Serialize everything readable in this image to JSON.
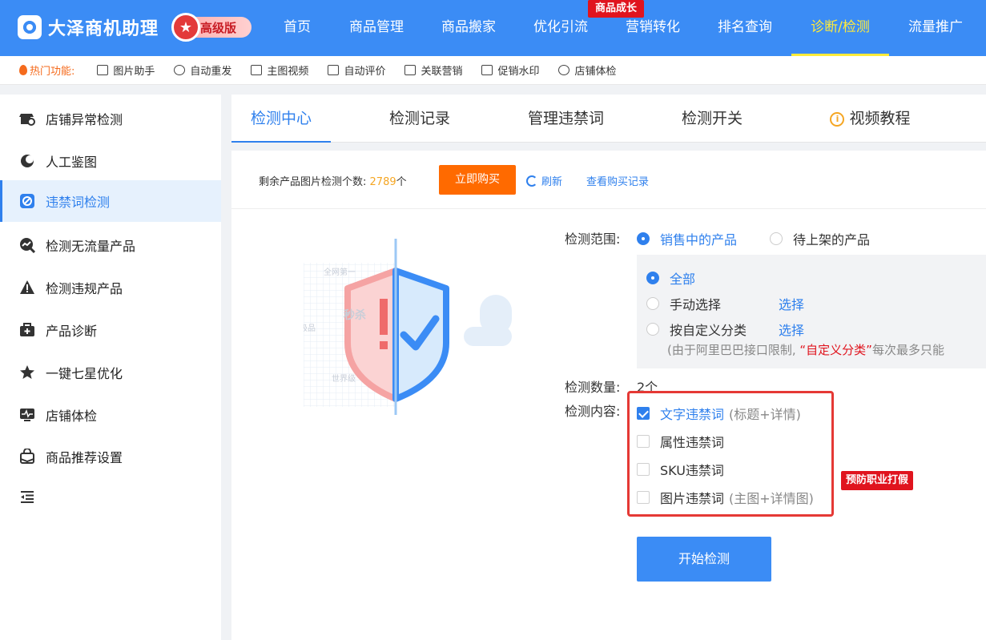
{
  "brand": {
    "name": "大泽商机助理",
    "badge": "高级版"
  },
  "nav": {
    "items": [
      "首页",
      "商品管理",
      "商品搬家",
      "优化引流",
      "营销转化",
      "排名查询",
      "诊断/检测",
      "流量推广"
    ],
    "active_index": 6,
    "tag": "商品成长"
  },
  "quickbar": {
    "label": "热门功能:",
    "items": [
      "图片助手",
      "自动重发",
      "主图视频",
      "自动评价",
      "关联营销",
      "促销水印",
      "店铺体检"
    ]
  },
  "sidebar": {
    "items": [
      "店铺异常检测",
      "人工鉴图",
      "违禁词检测",
      "检测无流量产品",
      "检测违规产品",
      "产品诊断",
      "一键七星优化",
      "店铺体检",
      "商品推荐设置"
    ],
    "active_index": 2
  },
  "tabs": [
    "检测中心",
    "检测记录",
    "管理违禁词",
    "检测开关",
    "视频教程"
  ],
  "status": {
    "prefix": "剩余产品图片检测个数:",
    "count": "2789",
    "suffix": "个",
    "buy": "立即购买",
    "refresh": "刷新",
    "history": "查看购买记录"
  },
  "illustration": {
    "words": [
      "全网第一",
      "秒杀",
      "极品",
      "世界级"
    ]
  },
  "form": {
    "scope_label": "检测范围:",
    "scope_options": [
      "销售中的产品",
      "待上架的产品"
    ],
    "sub_options": [
      "全部",
      "手动选择",
      "按自定义分类"
    ],
    "select_link": "选择",
    "note_prefix": "(由于阿里巴巴接口限制,",
    "note_highlight": "“自定义分类”",
    "note_suffix": "每次最多只能",
    "count_label": "检测数量:",
    "count_value": "2个",
    "content_label": "检测内容:",
    "content_options": [
      {
        "label": "文字违禁词",
        "hint": "(标题+详情)",
        "checked": true
      },
      {
        "label": "属性违禁词",
        "hint": "",
        "checked": false
      },
      {
        "label": "SKU违禁词",
        "hint": "",
        "checked": false
      },
      {
        "label": "图片违禁词",
        "hint": "(主图+详情图)",
        "checked": false
      }
    ],
    "warn_tag": "预防职业打假",
    "start_button": "开始检测"
  }
}
